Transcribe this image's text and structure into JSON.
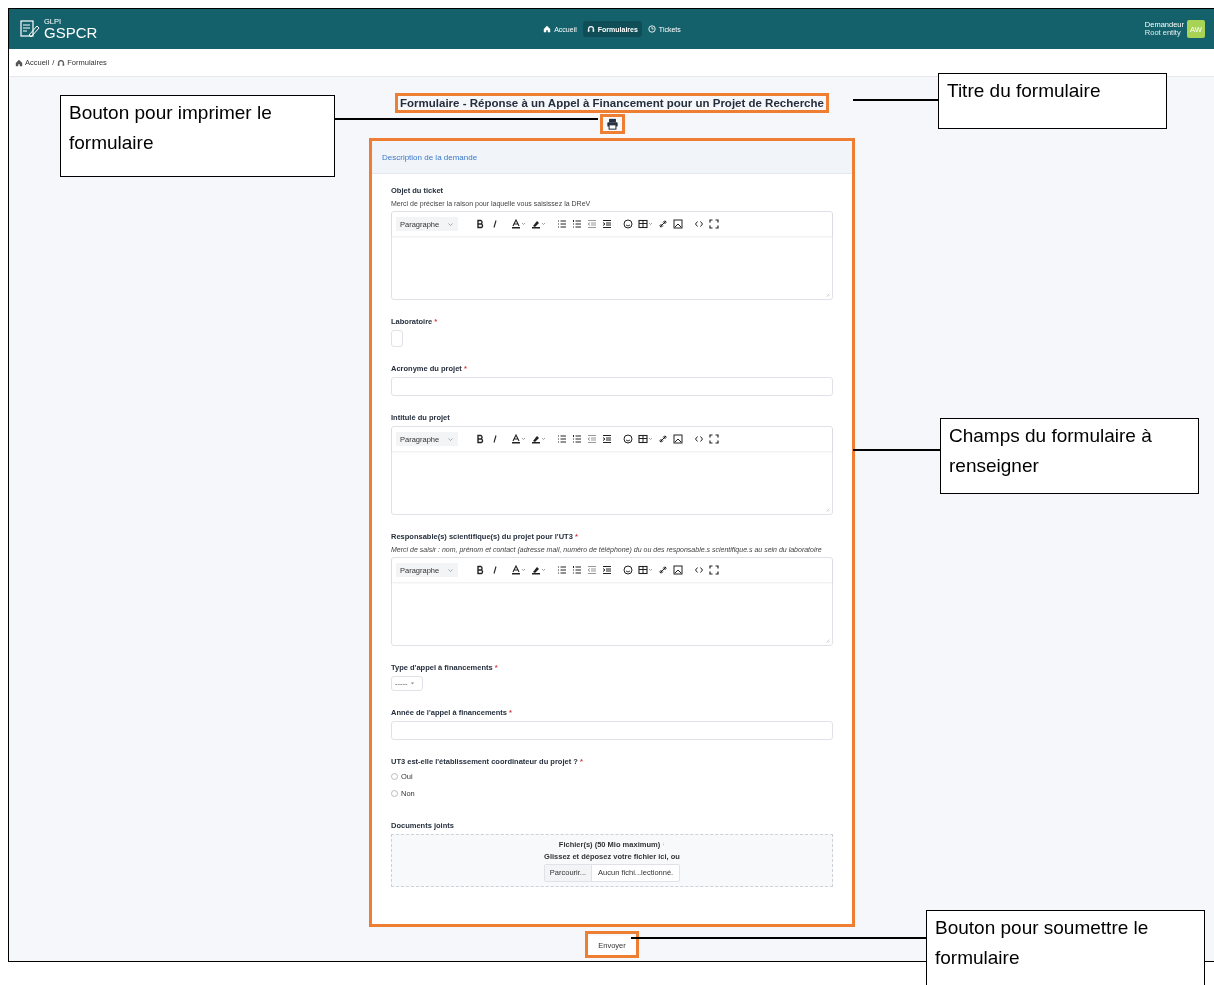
{
  "header": {
    "logo_small": "GLPI",
    "logo": "GSPCR",
    "nav": [
      {
        "label": "Accueil",
        "selected": false
      },
      {
        "label": "Formulaires",
        "selected": true
      },
      {
        "label": "Tickets",
        "selected": false
      }
    ],
    "user": {
      "role": "Demandeur",
      "entity": "Root entity",
      "initials": "AW"
    }
  },
  "breadcrumb": {
    "items": [
      "Accueil",
      "Formulaires"
    ],
    "separator": "/"
  },
  "form": {
    "title": "Formulaire - Réponse à un Appel à Financement pour un Projet de Recherche",
    "section": "Description de la demande",
    "fields": [
      {
        "kind": "editor",
        "label": "Objet du ticket",
        "help": "Merci de préciser la raison pour laquelle vous saisissez la DReV",
        "format": "Paragraphe"
      },
      {
        "kind": "empty_select",
        "label": "Laboratoire",
        "required_mark": "*"
      },
      {
        "kind": "text",
        "label": "Acronyme du projet",
        "required_mark": "*"
      },
      {
        "kind": "editor",
        "label": "Intitulé du projet",
        "format": "Paragraphe"
      },
      {
        "kind": "editor",
        "label": "Responsable(s) scientifique(s) du projet pour l'UT3",
        "required_mark": "*",
        "help": "Merci de saisir : nom, prénom et contact (adresse mail, numéro de téléphone) du ou des responsable.s scientifique.s au sein du laboratoire",
        "format": "Paragraphe"
      },
      {
        "kind": "dropdown",
        "label": "Type d'appel à financements",
        "required_mark": "*",
        "value": "-----"
      },
      {
        "kind": "text",
        "label": "Année de l'appel à financements",
        "required_mark": "*"
      },
      {
        "kind": "radio",
        "label": "UT3 est-elle l'établissement coordinateur du projet ?",
        "required_mark": "*",
        "options": [
          {
            "label": "Oui",
            "selected": false
          },
          {
            "label": "Non",
            "selected": false
          }
        ]
      },
      {
        "kind": "file",
        "label": "Documents joints",
        "limit": "Fichier(s) (50 Mio maximum)",
        "drop": "Glissez et déposez votre fichier ici, ou",
        "browse": "Parcourir...",
        "status": "Aucun fichi...lectionné."
      }
    ],
    "submit": "Envoyer"
  },
  "callouts": [
    {
      "kind": "title",
      "text": "Titre du formulaire"
    },
    {
      "kind": "print",
      "text": "Bouton pour imprimer le formulaire"
    },
    {
      "kind": "fields",
      "text": "Champs du formulaire à renseigner"
    },
    {
      "kind": "submit",
      "text": "Bouton pour soumettre le formulaire"
    }
  ]
}
